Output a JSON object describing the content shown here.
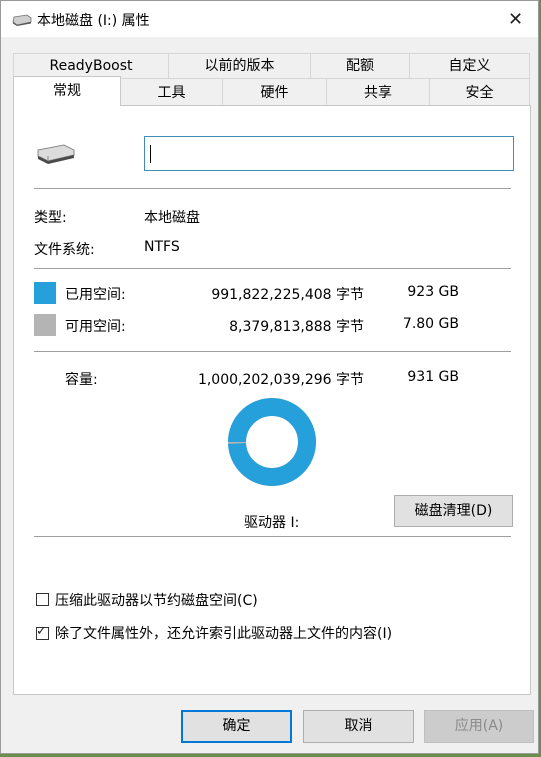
{
  "window": {
    "title": "本地磁盘 (I:) 属性",
    "close_glyph": "✕"
  },
  "tabs_row1": [
    "ReadyBoost",
    "以前的版本",
    "配额",
    "自定义"
  ],
  "tabs_row2": [
    "常规",
    "工具",
    "硬件",
    "共享",
    "安全"
  ],
  "active_tab": "常规",
  "general": {
    "name_value": "",
    "type_label": "类型:",
    "type_value": "本地磁盘",
    "fs_label": "文件系统:",
    "fs_value": "NTFS",
    "used": {
      "label": "已用空间:",
      "bytes": "991,822,225,408 字节",
      "size": "923 GB",
      "color": "#26a0da"
    },
    "free": {
      "label": "可用空间:",
      "bytes": "8,379,813,888 字节",
      "size": "7.80 GB",
      "color": "#b4b4b4"
    },
    "capacity": {
      "label": "容量:",
      "bytes": "1,000,202,039,296 字节",
      "size": "931 GB"
    },
    "drive_label": "驱动器 I:",
    "cleanup_button": "磁盘清理(D)",
    "used_fraction": 0.9916,
    "compress_label": "压缩此驱动器以节约磁盘空间(C)",
    "compress_checked": false,
    "index_label": "除了文件属性外，还允许索引此驱动器上文件的内容(I)",
    "index_checked": true
  },
  "footer": {
    "ok": "确定",
    "cancel": "取消",
    "apply": "应用(A)"
  },
  "icons": {
    "title": "drive-icon",
    "drive": "hard-drive-icon",
    "close": "close-icon",
    "check": "check-icon"
  }
}
